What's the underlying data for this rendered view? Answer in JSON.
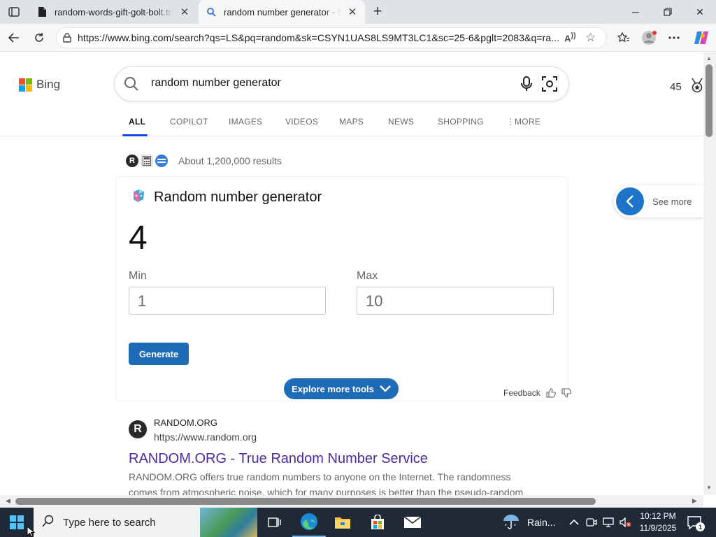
{
  "browser": {
    "tabs": [
      {
        "title": "random-words-gift-golt-bolt.trycl",
        "active": false
      },
      {
        "title": "random number generator - Search",
        "active": true
      }
    ],
    "url": "https://www.bing.com/search?qs=LS&pq=random&sk=CSYN1UAS8LS9MT3LC1&sc=25-6&pglt=2083&q=ra..."
  },
  "bing": {
    "logo_text": "Bing",
    "query": "random number generator",
    "rewards_points": "45",
    "nav": [
      "ALL",
      "COPILOT",
      "IMAGES",
      "VIDEOS",
      "MAPS",
      "NEWS",
      "SHOPPING",
      "MORE"
    ],
    "results_count": "About 1,200,000 results"
  },
  "rng_card": {
    "title": "Random number generator",
    "result": "4",
    "min_label": "Min",
    "min_value": "1",
    "max_label": "Max",
    "max_value": "10",
    "generate_label": "Generate",
    "explore_label": "Explore more tools",
    "feedback_label": "Feedback",
    "see_more_label": "See more"
  },
  "first_result": {
    "logo_letter": "R",
    "site": "RANDOM.ORG",
    "url": "https://www.random.org",
    "title": "RANDOM.ORG - True Random Number Service",
    "snippet": "RANDOM.ORG offers true random numbers to anyone on the Internet. The randomness comes from atmospheric noise, which for many purposes is better than the pseudo-random number ..."
  },
  "taskbar": {
    "search_placeholder": "Type here to search",
    "weather": "Rain...",
    "time": "10:12 PM",
    "date": "11/9/2025",
    "notification_count": "1"
  },
  "colors": {
    "accent_blue": "#1e6bb8",
    "link_visited": "#4b2c9c",
    "tab_underline": "#174ae4",
    "taskbar": "#1f2a36"
  }
}
